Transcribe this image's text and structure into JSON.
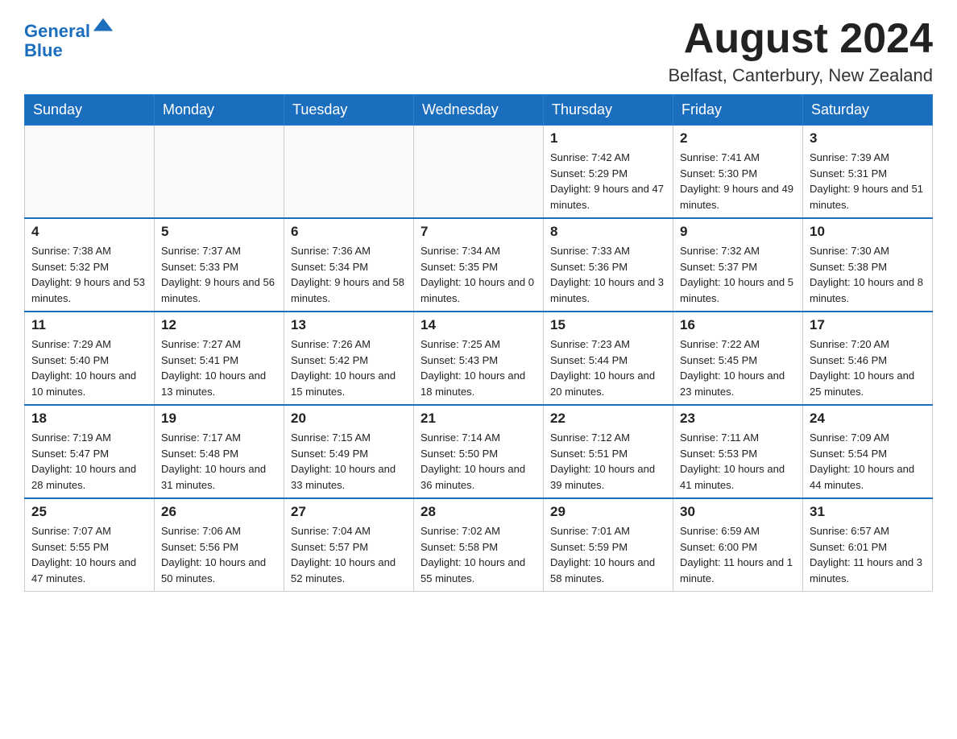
{
  "header": {
    "logo_text_general": "General",
    "logo_text_blue": "Blue",
    "month_title": "August 2024",
    "location": "Belfast, Canterbury, New Zealand"
  },
  "weekdays": [
    "Sunday",
    "Monday",
    "Tuesday",
    "Wednesday",
    "Thursday",
    "Friday",
    "Saturday"
  ],
  "weeks": [
    [
      {
        "day": "",
        "info": ""
      },
      {
        "day": "",
        "info": ""
      },
      {
        "day": "",
        "info": ""
      },
      {
        "day": "",
        "info": ""
      },
      {
        "day": "1",
        "info": "Sunrise: 7:42 AM\nSunset: 5:29 PM\nDaylight: 9 hours and 47 minutes."
      },
      {
        "day": "2",
        "info": "Sunrise: 7:41 AM\nSunset: 5:30 PM\nDaylight: 9 hours and 49 minutes."
      },
      {
        "day": "3",
        "info": "Sunrise: 7:39 AM\nSunset: 5:31 PM\nDaylight: 9 hours and 51 minutes."
      }
    ],
    [
      {
        "day": "4",
        "info": "Sunrise: 7:38 AM\nSunset: 5:32 PM\nDaylight: 9 hours and 53 minutes."
      },
      {
        "day": "5",
        "info": "Sunrise: 7:37 AM\nSunset: 5:33 PM\nDaylight: 9 hours and 56 minutes."
      },
      {
        "day": "6",
        "info": "Sunrise: 7:36 AM\nSunset: 5:34 PM\nDaylight: 9 hours and 58 minutes."
      },
      {
        "day": "7",
        "info": "Sunrise: 7:34 AM\nSunset: 5:35 PM\nDaylight: 10 hours and 0 minutes."
      },
      {
        "day": "8",
        "info": "Sunrise: 7:33 AM\nSunset: 5:36 PM\nDaylight: 10 hours and 3 minutes."
      },
      {
        "day": "9",
        "info": "Sunrise: 7:32 AM\nSunset: 5:37 PM\nDaylight: 10 hours and 5 minutes."
      },
      {
        "day": "10",
        "info": "Sunrise: 7:30 AM\nSunset: 5:38 PM\nDaylight: 10 hours and 8 minutes."
      }
    ],
    [
      {
        "day": "11",
        "info": "Sunrise: 7:29 AM\nSunset: 5:40 PM\nDaylight: 10 hours and 10 minutes."
      },
      {
        "day": "12",
        "info": "Sunrise: 7:27 AM\nSunset: 5:41 PM\nDaylight: 10 hours and 13 minutes."
      },
      {
        "day": "13",
        "info": "Sunrise: 7:26 AM\nSunset: 5:42 PM\nDaylight: 10 hours and 15 minutes."
      },
      {
        "day": "14",
        "info": "Sunrise: 7:25 AM\nSunset: 5:43 PM\nDaylight: 10 hours and 18 minutes."
      },
      {
        "day": "15",
        "info": "Sunrise: 7:23 AM\nSunset: 5:44 PM\nDaylight: 10 hours and 20 minutes."
      },
      {
        "day": "16",
        "info": "Sunrise: 7:22 AM\nSunset: 5:45 PM\nDaylight: 10 hours and 23 minutes."
      },
      {
        "day": "17",
        "info": "Sunrise: 7:20 AM\nSunset: 5:46 PM\nDaylight: 10 hours and 25 minutes."
      }
    ],
    [
      {
        "day": "18",
        "info": "Sunrise: 7:19 AM\nSunset: 5:47 PM\nDaylight: 10 hours and 28 minutes."
      },
      {
        "day": "19",
        "info": "Sunrise: 7:17 AM\nSunset: 5:48 PM\nDaylight: 10 hours and 31 minutes."
      },
      {
        "day": "20",
        "info": "Sunrise: 7:15 AM\nSunset: 5:49 PM\nDaylight: 10 hours and 33 minutes."
      },
      {
        "day": "21",
        "info": "Sunrise: 7:14 AM\nSunset: 5:50 PM\nDaylight: 10 hours and 36 minutes."
      },
      {
        "day": "22",
        "info": "Sunrise: 7:12 AM\nSunset: 5:51 PM\nDaylight: 10 hours and 39 minutes."
      },
      {
        "day": "23",
        "info": "Sunrise: 7:11 AM\nSunset: 5:53 PM\nDaylight: 10 hours and 41 minutes."
      },
      {
        "day": "24",
        "info": "Sunrise: 7:09 AM\nSunset: 5:54 PM\nDaylight: 10 hours and 44 minutes."
      }
    ],
    [
      {
        "day": "25",
        "info": "Sunrise: 7:07 AM\nSunset: 5:55 PM\nDaylight: 10 hours and 47 minutes."
      },
      {
        "day": "26",
        "info": "Sunrise: 7:06 AM\nSunset: 5:56 PM\nDaylight: 10 hours and 50 minutes."
      },
      {
        "day": "27",
        "info": "Sunrise: 7:04 AM\nSunset: 5:57 PM\nDaylight: 10 hours and 52 minutes."
      },
      {
        "day": "28",
        "info": "Sunrise: 7:02 AM\nSunset: 5:58 PM\nDaylight: 10 hours and 55 minutes."
      },
      {
        "day": "29",
        "info": "Sunrise: 7:01 AM\nSunset: 5:59 PM\nDaylight: 10 hours and 58 minutes."
      },
      {
        "day": "30",
        "info": "Sunrise: 6:59 AM\nSunset: 6:00 PM\nDaylight: 11 hours and 1 minute."
      },
      {
        "day": "31",
        "info": "Sunrise: 6:57 AM\nSunset: 6:01 PM\nDaylight: 11 hours and 3 minutes."
      }
    ]
  ]
}
